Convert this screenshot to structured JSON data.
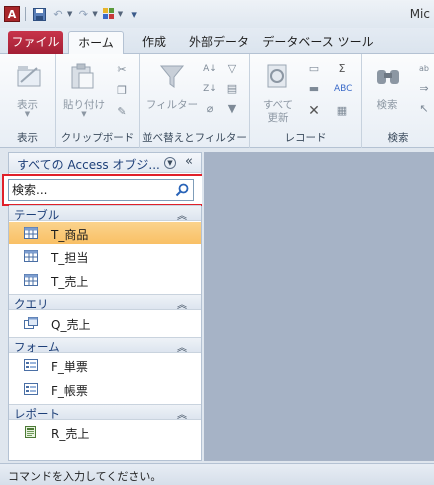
{
  "window": {
    "title_fragment": "Mic"
  },
  "qat": {
    "icons": [
      "access-app-icon",
      "save-icon",
      "undo-icon",
      "redo-icon",
      "customize-icon"
    ]
  },
  "tabs": [
    {
      "label": "ファイル",
      "active": false
    },
    {
      "label": "ホーム",
      "active": true
    },
    {
      "label": "作成",
      "active": false
    },
    {
      "label": "外部データ",
      "active": false
    },
    {
      "label": "データベース ツール",
      "active": false
    }
  ],
  "ribbon": {
    "groups": [
      {
        "name": "表示",
        "tools": [
          "表示"
        ]
      },
      {
        "name": "クリップボード",
        "tools": [
          "貼り付け"
        ]
      },
      {
        "name": "並べ替えとフィルター",
        "tools": [
          "フィルター"
        ]
      },
      {
        "name": "レコード",
        "tools": [
          "すべて",
          "更新"
        ]
      },
      {
        "name": "検索",
        "tools": [
          "検索"
        ]
      }
    ]
  },
  "nav": {
    "title": "すべての Access オブジ...",
    "search_placeholder": "検索...",
    "sections": [
      {
        "label": "テーブル",
        "items": [
          {
            "label": "T_商品",
            "selected": true
          },
          {
            "label": "T_担当",
            "selected": false
          },
          {
            "label": "T_売上",
            "selected": false
          }
        ]
      },
      {
        "label": "クエリ",
        "items": [
          {
            "label": "Q_売上",
            "selected": false
          }
        ]
      },
      {
        "label": "フォーム",
        "items": [
          {
            "label": "F_単票",
            "selected": false
          },
          {
            "label": "F_帳票",
            "selected": false
          }
        ]
      },
      {
        "label": "レポート",
        "items": [
          {
            "label": "R_売上",
            "selected": false
          }
        ]
      }
    ]
  },
  "status": {
    "text": "コマンドを入力してください。"
  },
  "colors": {
    "file_tab": "#b52a40",
    "selected_item": "#fbc977",
    "highlight_border": "#e0202a",
    "work_area": "#a6b3c6"
  }
}
